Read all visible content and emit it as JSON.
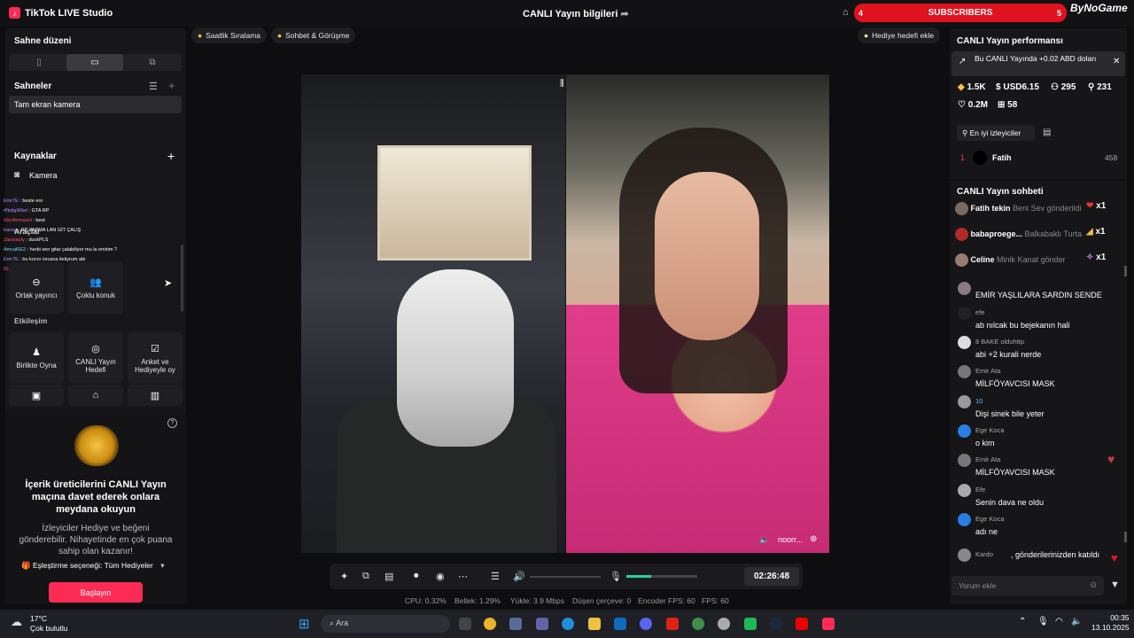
{
  "app": {
    "name": "TikTok LIVE Studio",
    "window_title": "CANLI Yayın bilgileri",
    "brand": "ByNoGame"
  },
  "subscribers_banner": {
    "left_count": "4",
    "label": "SUBSCRIBERS",
    "right_count": "5"
  },
  "left_panel": {
    "layout_title": "Sahne düzeni",
    "scenes_title": "Sahneler",
    "scene_item": "Tam ekran kamera",
    "sources_title": "Kaynaklar",
    "source_item": "Kamera",
    "tools_title": "Araçlar",
    "tools": [
      "Ortak yayıncı",
      "Çoklu konuk"
    ],
    "interaction_title": "Etkileşim",
    "interaction": [
      "Birlikte Oyna",
      "CANLI Yayın Hedefi",
      "Anket ve Hediyeyle oy"
    ],
    "chat_overlay": [
      {
        "user": "Emr7E",
        "text": "beste eor"
      },
      {
        "user": "#fistigiWart",
        "text": "GTA RP"
      },
      {
        "user": "Sinvfermasol",
        "text": "best"
      },
      {
        "user": "hansp",
        "text": "RP YAPMA LAN GİT ÇALIŞ"
      },
      {
        "user": "Zaosiauty",
        "text": "duckPLS"
      },
      {
        "user": "Amcal6E2",
        "text": "herkt sen gitar çalabiliyor mu la emirim ?"
      },
      {
        "user": "Emr7E",
        "text": "bu kızını özcana iletiyrum abi"
      },
      {
        "user": "lGenerator",
        "text": ""
      }
    ],
    "promo_title": "İçerik üreticilerini CANLI Yayın maçına davet ederek onlara meydana okuyun",
    "promo_text": "İzleyiciler Hediye ve beğeni gönderebilir. Nihayetinde en çok puana sahip olan kazanır!",
    "pairing_label": "Eşleştirme seçeneği: Tüm Hediyeler",
    "start_button": "Başlayın"
  },
  "center": {
    "pills": [
      "Saatlik Sıralama",
      "Sohbet & Görüşme"
    ],
    "gift_goal": "Hediye hedefi ekle",
    "guest_name": "noorr...",
    "timer": "02:26:48",
    "stats": [
      {
        "label": "CPU:",
        "value": "0.32%"
      },
      {
        "label": "Bellek:",
        "value": "1.29%"
      },
      {
        "label": "Yükle:",
        "value": "3.9 Mbps"
      },
      {
        "label": "Düşen çerçeve:",
        "value": "0"
      },
      {
        "label": "Encoder FPS:",
        "value": "60"
      },
      {
        "label": "FPS:",
        "value": "60"
      }
    ],
    "mic_level": 0.35
  },
  "right_panel": {
    "perf_title": "CANLI Yayın performansı",
    "tip": "Bu CANLI Yayında +0.02 ABD doları",
    "kpis": {
      "diamonds": "1.5K",
      "usd": "USD6.15",
      "viewers": "295",
      "followers": "231",
      "likes": "0.2M",
      "gifts": "58"
    },
    "top_viewers_button": "En iyi izleyiciler",
    "top_viewer": {
      "rank": "1",
      "name": "Fatih",
      "score": "458"
    },
    "chat_title": "CANLI Yayın sohbeti",
    "gifts": [
      {
        "user": "Fatih tekin",
        "text": "Beni Sev gönderildi",
        "count": "x1"
      },
      {
        "user": "babaproege...",
        "text": "Balkabaklı Turta",
        "count": "x1"
      },
      {
        "user": "Celine",
        "text": "Minik Kanat gönder",
        "count": "x1"
      }
    ],
    "messages": [
      {
        "user": "",
        "text": "EMİR YAŞLILARA SARDIN SENDE"
      },
      {
        "user": "efe",
        "text": "ab nılcak bu bejekanın hali"
      },
      {
        "user": "8 BAKE olduhttp",
        "text": "abi +2 kurali nerde"
      },
      {
        "user": "Emir Ata",
        "text": "MİLFÖYAVCISI MASK"
      },
      {
        "user": "10",
        "text": "Dişi sinek bile yeter"
      },
      {
        "user": "Ege Koca",
        "text": "o kim"
      },
      {
        "user": "Emir Ata",
        "text": "MİLFÖYAVCISI MASK"
      },
      {
        "user": "Efe",
        "text": "Senin dava ne oldu"
      },
      {
        "user": "Ege Koca",
        "text": "adı ne"
      },
      {
        "user": "Kardo",
        "text": ", gönderilerinizden katıldı"
      }
    ],
    "comment_placeholder": "Yorum ekle"
  },
  "taskbar": {
    "weather_temp": "17°C",
    "weather_desc": "Çok bulutlu",
    "search_placeholder": "Ara",
    "time": "00:35",
    "date": "13.10.2025"
  },
  "colors": {
    "accent": "#fe2c55",
    "banner": "#e0121f",
    "panel": "#17171a"
  }
}
